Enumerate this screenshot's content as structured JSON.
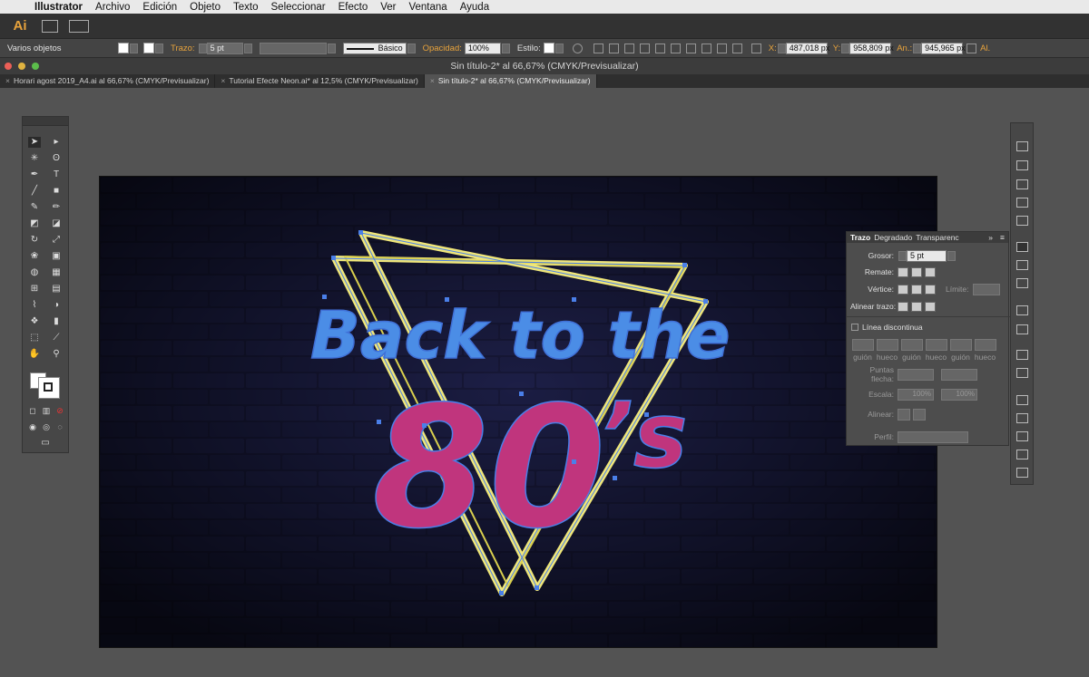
{
  "menubar": {
    "app_name": "Illustrator",
    "items": [
      "Archivo",
      "Edición",
      "Objeto",
      "Texto",
      "Seleccionar",
      "Efecto",
      "Ver",
      "Ventana",
      "Ayuda"
    ]
  },
  "appbar": {
    "logo_text": "Ai"
  },
  "control": {
    "selection_label": "Varios objetos",
    "stroke_label": "Trazo:",
    "stroke_weight": "5 pt",
    "brush_label": "Básico",
    "opacity_label": "Opacidad:",
    "opacity_value": "100%",
    "style_label": "Estilo:",
    "x_label": "X:",
    "x_value": "487,018 px",
    "y_label": "Y:",
    "y_value": "958,809 px",
    "w_label": "An.:",
    "w_value": "945,965 px",
    "h_label": "Al."
  },
  "window": {
    "title": "Sin título-2* al 66,67% (CMYK/Previsualizar)"
  },
  "tabs": [
    {
      "label": "Horari agost 2019_A4.ai al 66,67% (CMYK/Previsualizar)",
      "active": false
    },
    {
      "label": "Tutorial Efecte Neon.ai* al 12,5% (CMYK/Previsualizar)",
      "active": false
    },
    {
      "label": "Sin título-2* al 66,67% (CMYK/Previsualizar)",
      "active": true
    }
  ],
  "artwork": {
    "line1": "Back to the",
    "line2": "80",
    "suffix": "’s",
    "colors": {
      "background": "#141432",
      "neon_blue": "#4b8de6",
      "neon_pink": "#c0357d",
      "neon_yellow": "#efe67a",
      "selection": "#4a7fe8"
    }
  },
  "stroke_panel": {
    "tabs": [
      "Trazo",
      "Degradado",
      "Transparenc"
    ],
    "weight_label": "Grosor:",
    "weight_value": "5 pt",
    "cap_label": "Remate:",
    "corner_label": "Vértice:",
    "limit_label": "Límite:",
    "align_label": "Alinear trazo:",
    "dashed_label": "Línea discontinua",
    "dash_labels": [
      "guión",
      "hueco",
      "guión",
      "hueco",
      "guión",
      "hueco"
    ],
    "arrows_label": "Puntas flecha:",
    "scale_label": "Escala:",
    "scale_values": [
      "100%",
      "100%"
    ],
    "align_arrows_label": "Alinear:",
    "profile_label": "Perfil:"
  }
}
